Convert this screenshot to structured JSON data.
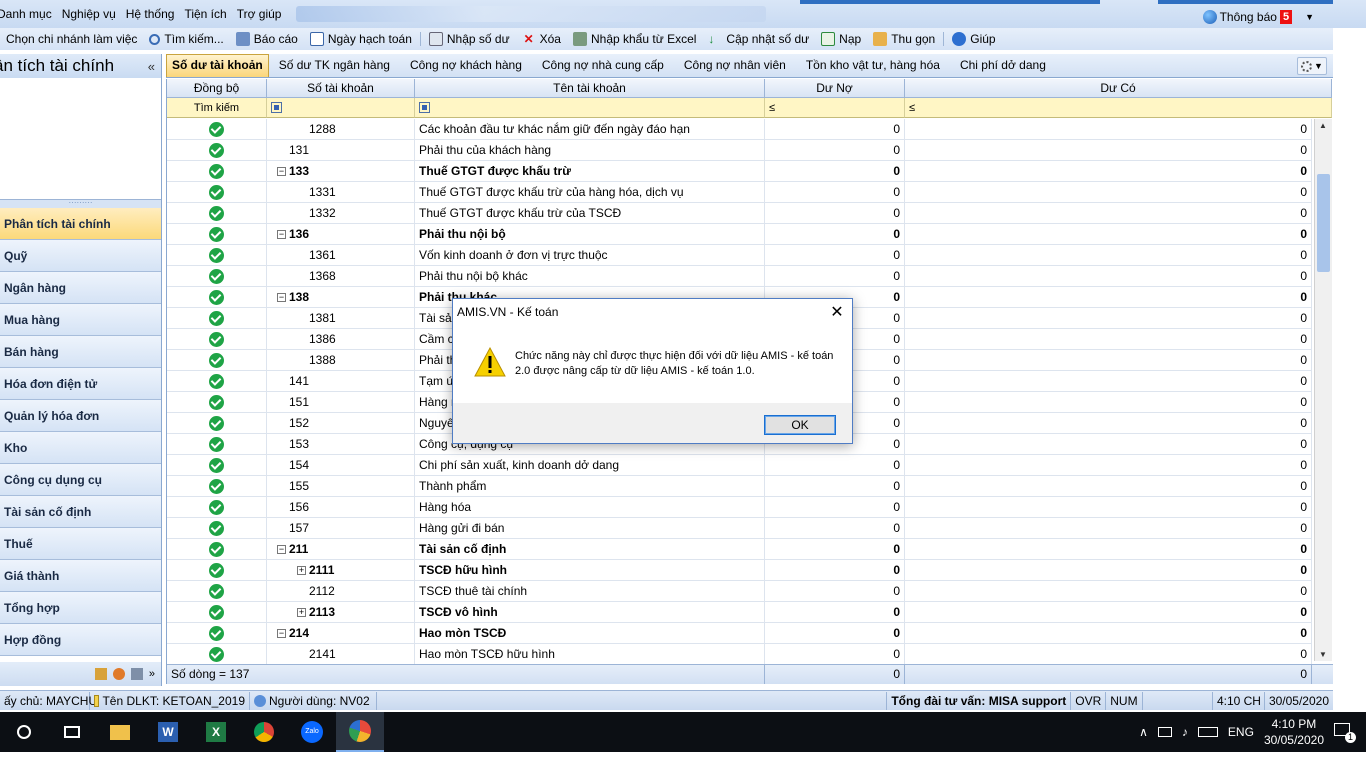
{
  "menubar": {
    "items": [
      "Danh mục",
      "Nghiệp vụ",
      "Hệ thống",
      "Tiện ích",
      "Trợ giúp"
    ],
    "notification_label": "Thông báo",
    "notification_count": "5"
  },
  "toolbar": {
    "branch": "Chọn chi nhánh làm việc",
    "search": "Tìm kiếm...",
    "report": "Báo cáo",
    "posting_date": "Ngày hạch toán",
    "enter_balance": "Nhập số dư",
    "delete": "Xóa",
    "import_excel": "Nhập khẩu từ Excel",
    "update_balance": "Cập nhật số dư",
    "load": "Nạp",
    "collapse": "Thu gọn",
    "help": "Giúp"
  },
  "left": {
    "title": "ân tích tài chính",
    "collapse": "«",
    "items": [
      "Phân tích tài chính",
      "Quỹ",
      "Ngân hàng",
      "Mua hàng",
      "Bán hàng",
      "Hóa đơn điện tử",
      "Quản lý hóa đơn",
      "Kho",
      "Công cụ dụng cụ",
      "Tài sản cố định",
      "Thuế",
      "Giá thành",
      "Tổng hợp",
      "Hợp đồng"
    ]
  },
  "tabs": [
    "Số dư tài khoản",
    "Số dư TK ngân hàng",
    "Công nợ khách hàng",
    "Công nợ nhà cung cấp",
    "Công nợ nhân viên",
    "Tồn kho vật tư, hàng hóa",
    "Chi phí dở dang"
  ],
  "grid": {
    "headers": [
      "Đồng bộ",
      "Số tài khoản",
      "Tên tài khoản",
      "Dư Nợ",
      "Dư Có"
    ],
    "filter_label": "Tìm kiếm",
    "filter_op": "≤",
    "rows": [
      {
        "account": "1288",
        "name": "Các khoản đầu tư khác nắm giữ đến ngày đáo hạn",
        "debit": "0",
        "credit": "0",
        "level": 2,
        "bold": false,
        "toggle": ""
      },
      {
        "account": "131",
        "name": "Phải thu của khách hàng",
        "debit": "0",
        "credit": "0",
        "level": 1,
        "bold": false,
        "toggle": ""
      },
      {
        "account": "133",
        "name": "Thuế GTGT được khấu trừ",
        "debit": "0",
        "credit": "0",
        "level": 1,
        "bold": true,
        "toggle": "−"
      },
      {
        "account": "1331",
        "name": "Thuế GTGT được khấu trừ của hàng hóa, dịch vụ",
        "debit": "0",
        "credit": "0",
        "level": 2,
        "bold": false,
        "toggle": ""
      },
      {
        "account": "1332",
        "name": "Thuế GTGT được khấu trừ của TSCĐ",
        "debit": "0",
        "credit": "0",
        "level": 2,
        "bold": false,
        "toggle": ""
      },
      {
        "account": "136",
        "name": "Phải thu nội bộ",
        "debit": "0",
        "credit": "0",
        "level": 1,
        "bold": true,
        "toggle": "−"
      },
      {
        "account": "1361",
        "name": "Vốn kinh doanh ở đơn vị trực thuộc",
        "debit": "0",
        "credit": "0",
        "level": 2,
        "bold": false,
        "toggle": ""
      },
      {
        "account": "1368",
        "name": "Phải thu nội bộ khác",
        "debit": "0",
        "credit": "0",
        "level": 2,
        "bold": false,
        "toggle": ""
      },
      {
        "account": "138",
        "name": "Phải thu khác",
        "debit": "0",
        "credit": "0",
        "level": 1,
        "bold": true,
        "toggle": "−"
      },
      {
        "account": "1381",
        "name": "Tài sản",
        "debit": "0",
        "credit": "0",
        "level": 2,
        "bold": false,
        "toggle": ""
      },
      {
        "account": "1386",
        "name": "Cầm c",
        "debit": "0",
        "credit": "0",
        "level": 2,
        "bold": false,
        "toggle": ""
      },
      {
        "account": "1388",
        "name": "Phải th",
        "debit": "0",
        "credit": "0",
        "level": 2,
        "bold": false,
        "toggle": ""
      },
      {
        "account": "141",
        "name": "Tạm ứn",
        "debit": "0",
        "credit": "0",
        "level": 1,
        "bold": false,
        "toggle": ""
      },
      {
        "account": "151",
        "name": "Hàng m",
        "debit": "0",
        "credit": "0",
        "level": 1,
        "bold": false,
        "toggle": ""
      },
      {
        "account": "152",
        "name": "Nguyên",
        "debit": "0",
        "credit": "0",
        "level": 1,
        "bold": false,
        "toggle": ""
      },
      {
        "account": "153",
        "name": "Công cụ, dụng cụ",
        "debit": "0",
        "credit": "0",
        "level": 1,
        "bold": false,
        "toggle": ""
      },
      {
        "account": "154",
        "name": "Chi phí sản xuất, kinh doanh dở dang",
        "debit": "0",
        "credit": "0",
        "level": 1,
        "bold": false,
        "toggle": ""
      },
      {
        "account": "155",
        "name": "Thành phẩm",
        "debit": "0",
        "credit": "0",
        "level": 1,
        "bold": false,
        "toggle": ""
      },
      {
        "account": "156",
        "name": "Hàng hóa",
        "debit": "0",
        "credit": "0",
        "level": 1,
        "bold": false,
        "toggle": ""
      },
      {
        "account": "157",
        "name": "Hàng gửi đi bán",
        "debit": "0",
        "credit": "0",
        "level": 1,
        "bold": false,
        "toggle": ""
      },
      {
        "account": "211",
        "name": "Tài sản cố định",
        "debit": "0",
        "credit": "0",
        "level": 1,
        "bold": true,
        "toggle": "−"
      },
      {
        "account": "2111",
        "name": "TSCĐ hữu hình",
        "debit": "0",
        "credit": "0",
        "level": 2,
        "bold": true,
        "toggle": "+"
      },
      {
        "account": "2112",
        "name": "TSCĐ thuê tài chính",
        "debit": "0",
        "credit": "0",
        "level": 2,
        "bold": false,
        "toggle": ""
      },
      {
        "account": "2113",
        "name": "TSCĐ vô hình",
        "debit": "0",
        "credit": "0",
        "level": 2,
        "bold": true,
        "toggle": "+"
      },
      {
        "account": "214",
        "name": "Hao mòn TSCĐ",
        "debit": "0",
        "credit": "0",
        "level": 1,
        "bold": true,
        "toggle": "−"
      },
      {
        "account": "2141",
        "name": "Hao mòn TSCĐ hữu hình",
        "debit": "0",
        "credit": "0",
        "level": 2,
        "bold": false,
        "toggle": ""
      }
    ],
    "footer": {
      "row_count": "Số dòng = 137",
      "debit_total": "0",
      "credit_total": "0"
    }
  },
  "statusbar": {
    "server": "ấy chủ: MAYCHU",
    "dataset": "Tên DLKT: KETOAN_2019",
    "user": "Người dùng: NV02",
    "hotline": "Tổng đài tư vấn: MISA support",
    "ovr": "OVR",
    "num": "NUM",
    "time": "4:10 CH",
    "date": "30/05/2020"
  },
  "dialog": {
    "title": "AMIS.VN - Kế toán",
    "message": "Chức năng này chỉ được thực hiện đối với dữ liệu AMIS - kế toán 2.0 được nâng cấp từ dữ liệu AMIS - kế toán 1.0.",
    "ok": "OK"
  },
  "taskbar": {
    "lang": "ENG",
    "time": "4:10 PM",
    "date": "30/05/2020",
    "notif_count": "1"
  }
}
